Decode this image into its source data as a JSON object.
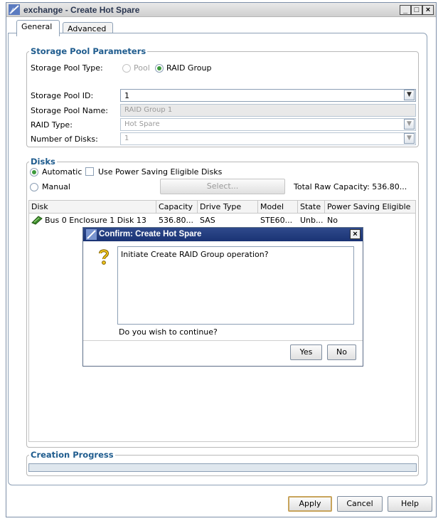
{
  "window": {
    "title": "exchange - Create Hot Spare",
    "minimize_label": "_",
    "maximize_label": "□",
    "close_label": "×"
  },
  "tabs": [
    {
      "label": "General",
      "active": true
    },
    {
      "label": "Advanced",
      "active": false
    }
  ],
  "storage_pool": {
    "legend": "Storage Pool Parameters",
    "type_label": "Storage Pool Type:",
    "option_pool": "Pool",
    "option_raid": "RAID Group",
    "selected_type": "RAID Group",
    "id_label": "Storage Pool ID:",
    "id_value": "1",
    "name_label": "Storage Pool Name:",
    "name_value": "RAID Group 1",
    "raid_type_label": "RAID Type:",
    "raid_type_value": "Hot Spare",
    "num_disks_label": "Number of Disks:",
    "num_disks_value": "1"
  },
  "disks": {
    "legend": "Disks",
    "option_automatic": "Automatic",
    "power_saving_label": "Use Power Saving Eligible Disks",
    "power_saving_checked": false,
    "option_manual": "Manual",
    "select_button": "Select...",
    "total_raw_capacity": "Total Raw Capacity: 536.80...",
    "columns": [
      "Disk",
      "Capacity",
      "Drive Type",
      "Model",
      "State",
      "Power Saving Eligible"
    ],
    "rows": [
      [
        "Bus 0 Enclosure 1 Disk 13",
        "536.80...",
        "SAS",
        "STE60...",
        "Unb...",
        "No"
      ]
    ]
  },
  "creation_progress": {
    "legend": "Creation Progress",
    "progress": 0
  },
  "footer": {
    "apply": "Apply",
    "cancel": "Cancel",
    "help": "Help"
  },
  "dialog": {
    "title": "Confirm: Create Hot Spare",
    "message": "Initiate Create RAID Group operation?",
    "question": "Do you wish to continue?",
    "yes": "Yes",
    "no": "No",
    "close_label": "×"
  },
  "colors": {
    "legend_text": "#1f5c8e",
    "dialog_title_bg": "#1a3374",
    "focus_border": "#c8a45c",
    "radio_selected": "#3c9a3c"
  },
  "icons": [
    "app-window-icon",
    "disk-icon",
    "question-icon"
  ]
}
